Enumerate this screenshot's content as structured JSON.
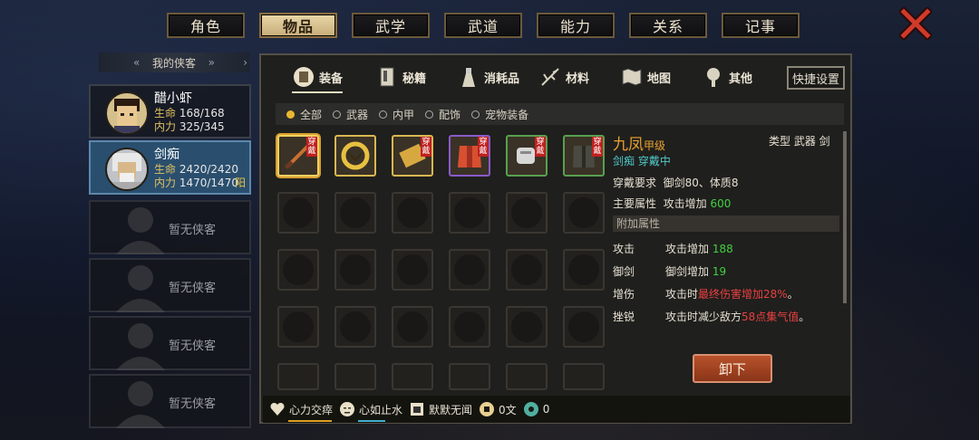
{
  "top_tabs": [
    "角色",
    "物品",
    "武学",
    "武道",
    "能力",
    "关系",
    "记事"
  ],
  "top_active": 1,
  "left": {
    "header": "我的侠客",
    "heroes": [
      {
        "name": "醋小虾",
        "hp_label": "生命",
        "hp": "168/168",
        "mp_label": "内力",
        "mp": "325/345"
      },
      {
        "name": "剑痴",
        "hp_label": "生命",
        "hp": "2420/2420",
        "mp_label": "内力",
        "mp": "1470/1470",
        "tag": "阳"
      }
    ],
    "empty_label": "暂无侠客"
  },
  "subtabs": [
    "装备",
    "秘籍",
    "消耗品",
    "材料",
    "地图",
    "其他"
  ],
  "quick_setting": "快捷设置",
  "filters": [
    "全部",
    "武器",
    "内甲",
    "配饰",
    "宠物装备"
  ],
  "equipped_badge": "穿戴",
  "detail": {
    "name": "九凤",
    "grade": "甲级",
    "type_label": "类型",
    "type_value": "武器 剑",
    "wearing": "剑痴 穿戴中",
    "req_label": "穿戴要求",
    "req_value": "御剑80、体质8",
    "main_label": "主要属性",
    "main_prefix": "攻击增加 ",
    "main_num": "600",
    "extra_header": "附加属性",
    "attrs": [
      {
        "k": "攻击",
        "v": "攻击增加 ",
        "n": "188",
        "tail": ""
      },
      {
        "k": "御剑",
        "v": "御剑增加 ",
        "n": "19",
        "tail": ""
      },
      {
        "k": "增伤",
        "v": "攻击时",
        "n": "最终伤害增加28%",
        "tail": "。"
      },
      {
        "k": "挫锐",
        "v": "攻击时减少敌方",
        "n": "58点集气值",
        "tail": "。"
      }
    ],
    "button": "卸下"
  },
  "bottom": [
    {
      "label": "心力交瘁",
      "icon": "heart-break-icon"
    },
    {
      "label": "心如止水",
      "icon": "calm-face-icon"
    },
    {
      "label": "默默无闻",
      "icon": "anonymous-icon"
    },
    {
      "label": "0文",
      "icon": "coin-icon"
    },
    {
      "label": "0",
      "icon": "jade-icon"
    }
  ]
}
